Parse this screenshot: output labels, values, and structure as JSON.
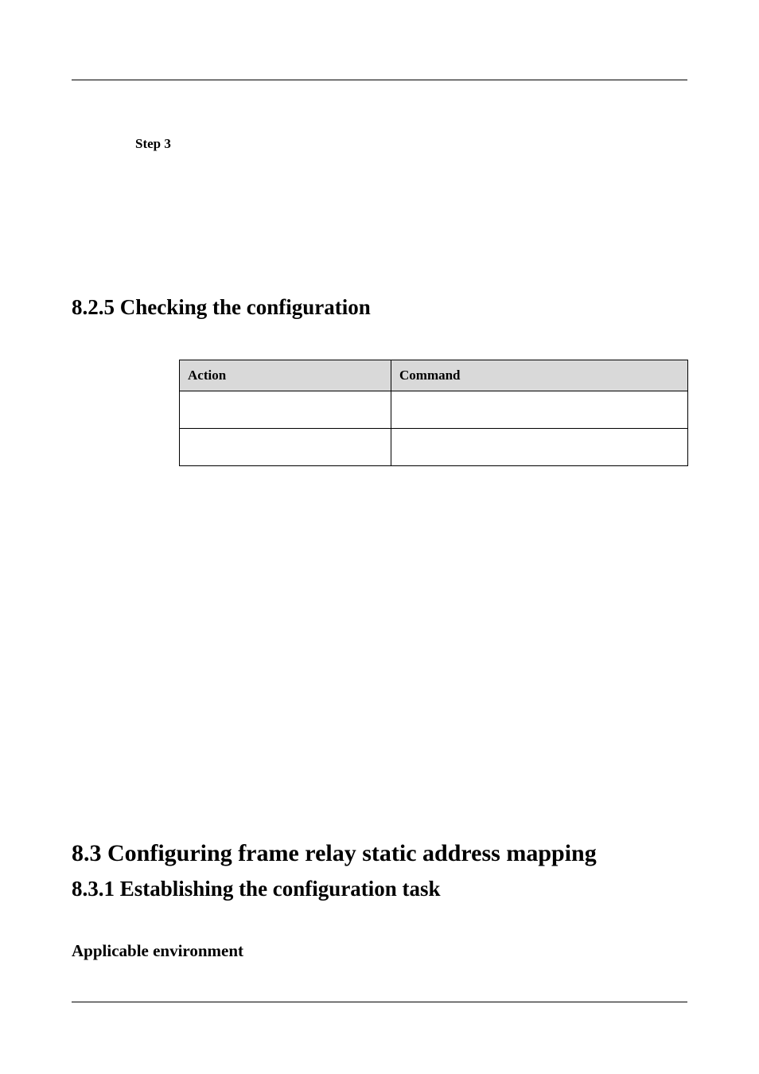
{
  "step": {
    "label": "Step 3"
  },
  "section_825": {
    "heading": "8.2.5 Checking the configuration"
  },
  "table": {
    "headers": {
      "action": "Action",
      "command": "Command"
    },
    "rows": [
      {
        "action": "",
        "command": ""
      },
      {
        "action": "",
        "command": ""
      }
    ]
  },
  "section_83": {
    "heading": "8.3 Configuring frame relay static address mapping"
  },
  "section_831": {
    "heading": "8.3.1 Establishing the configuration task"
  },
  "applicable_env": {
    "heading": "Applicable environment"
  }
}
